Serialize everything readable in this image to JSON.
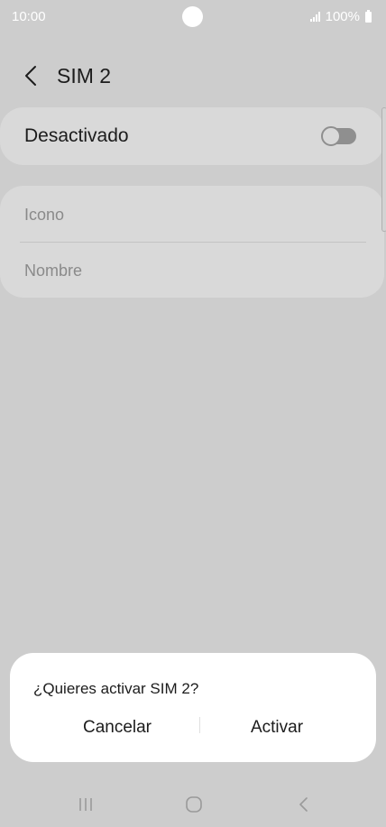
{
  "status_bar": {
    "time": "10:00",
    "battery": "100%"
  },
  "header": {
    "title": "SIM 2"
  },
  "toggle": {
    "label": "Desactivado",
    "on": false
  },
  "fields": {
    "icon_label": "Icono",
    "name_label": "Nombre"
  },
  "dialog": {
    "message": "¿Quieres activar SIM 2?",
    "cancel_label": "Cancelar",
    "activate_label": "Activar"
  },
  "icons": [
    "back-arrow-icon",
    "signal-icon",
    "battery-icon",
    "recents-icon",
    "home-icon",
    "nav-back-icon"
  ]
}
